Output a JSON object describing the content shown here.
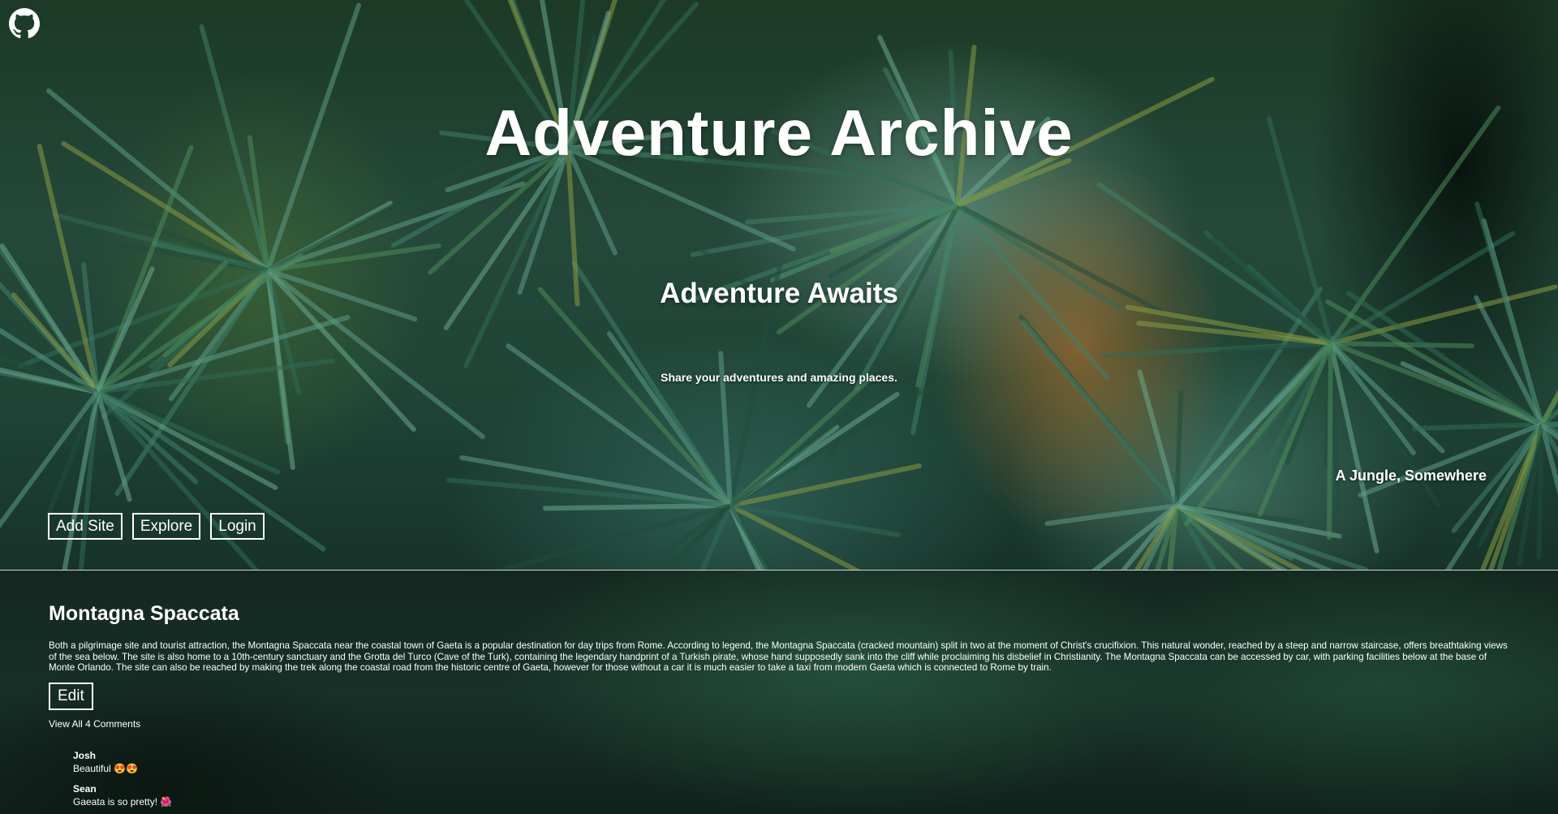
{
  "header": {
    "github_icon": "github-icon",
    "title": "Adventure Archive",
    "subtitle": "Adventure Awaits",
    "tagline": "Share your adventures and amazing places.",
    "photo_caption": "A Jungle, Somewhere"
  },
  "nav": {
    "add_site": "Add Site",
    "explore": "Explore",
    "login": "Login"
  },
  "site": {
    "name": "Montagna Spaccata",
    "description": "Both a pilgrimage site and tourist attraction, the Montagna Spaccata near the coastal town of Gaeta is a popular destination for day trips from Rome. According to legend, the Montagna Spaccata (cracked mountain) split in two at the moment of Christ's crucifixion. This natural wonder, reached by a steep and narrow staircase, offers breathtaking views of the sea below. The site is also home to a 10th-century sanctuary and the Grotta del Turco (Cave of the Turk), containing the legendary handprint of a Turkish pirate, whose hand supposedly sank into the cliff while proclaiming his disbelief in Christianity. The Montagna Spaccata can be accessed by car, with parking facilities below at the base of Monte Orlando. The site can also be reached by making the trek along the coastal road from the historic centre of Gaeta, however for those without a car it is much easier to take a taxi from modern Gaeta which is connected to Rome by train.",
    "edit_label": "Edit",
    "view_comments": "View All 4 Comments"
  },
  "comments": [
    {
      "author": "Josh",
      "text": "Beautiful 😍😍"
    },
    {
      "author": "Sean",
      "text": "Gaeata is so pretty! 🌺"
    }
  ],
  "colors": {
    "text": "#ffffff",
    "content_bg": "#13271f"
  }
}
